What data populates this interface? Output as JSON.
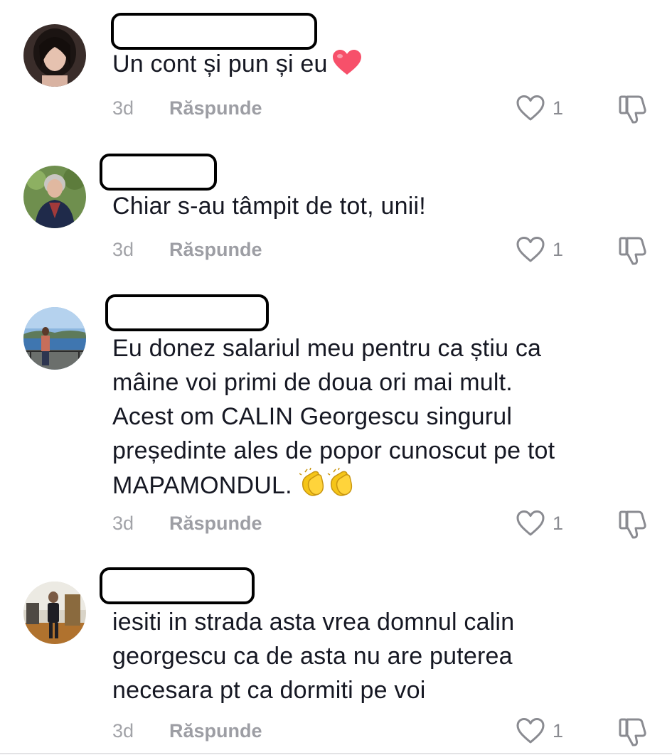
{
  "comments": [
    {
      "text": "Un cont și pun și eu",
      "emoji": "heart",
      "time": "3d",
      "reply_label": "Răspunde",
      "like_count": "1"
    },
    {
      "text": "Chiar s-au tâmpit de tot, unii!",
      "time": "3d",
      "reply_label": "Răspunde",
      "like_count": "1"
    },
    {
      "lines": [
        "Eu donez salariul meu pentru ca știu ca",
        "mâine voi primi de doua ori mai mult.",
        "Acest om CALIN Georgescu singurul",
        "președinte ales de popor cunoscut pe tot",
        "MAPAMONDUL."
      ],
      "emoji": "clapping-hands x2",
      "time": "3d",
      "reply_label": "Răspunde",
      "like_count": "1"
    },
    {
      "lines": [
        "iesiti in strada asta vrea domnul calin",
        "georgescu ca de asta nu are puterea",
        "necesara pt ca dormiti pe voi"
      ],
      "time": "3d",
      "reply_label": "Răspunde",
      "like_count": "1"
    }
  ],
  "icons": {
    "like": "heart-outline-icon",
    "dislike": "thumbs-down-icon"
  },
  "colors": {
    "text": "#161823",
    "muted": "#a2a3a8",
    "heart_emoji": "#f7506a",
    "clap_emoji": "#f5c518"
  }
}
